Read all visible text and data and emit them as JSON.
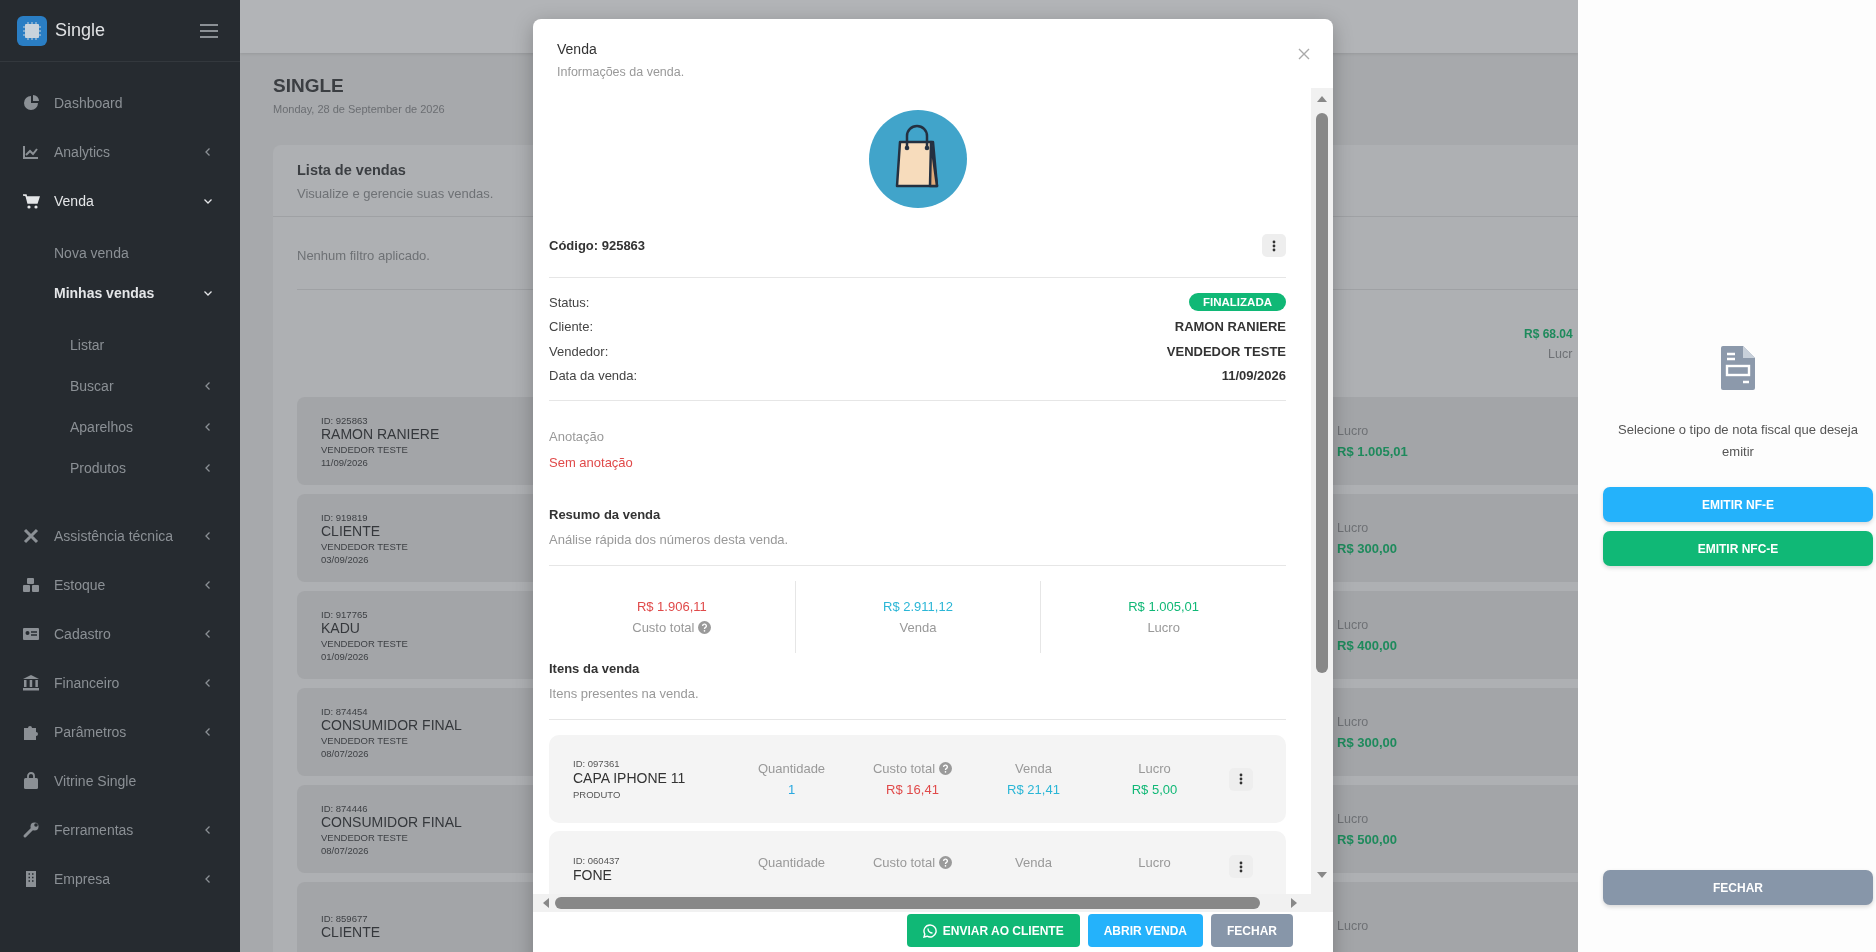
{
  "sidebar": {
    "brand": "Single",
    "items": [
      {
        "label": "Dashboard",
        "selected": false
      },
      {
        "label": "Analytics",
        "selected": false,
        "expanded": false
      },
      {
        "label": "Venda",
        "selected": true,
        "expanded": true,
        "children": [
          {
            "label": "Nova venda",
            "selected": false
          },
          {
            "label": "Minhas vendas",
            "selected": true,
            "expanded": true,
            "children": [
              {
                "label": "Listar",
                "selected": false
              },
              {
                "label": "Buscar",
                "selected": false,
                "expanded": false
              },
              {
                "label": "Aparelhos",
                "selected": false,
                "expanded": false
              },
              {
                "label": "Produtos",
                "selected": false,
                "expanded": false
              }
            ]
          }
        ]
      },
      {
        "label": "Assistência técnica",
        "selected": false,
        "expanded": false
      },
      {
        "label": "Estoque",
        "selected": false,
        "expanded": false
      },
      {
        "label": "Cadastro",
        "selected": false,
        "expanded": false
      },
      {
        "label": "Financeiro",
        "selected": false,
        "expanded": false
      },
      {
        "label": "Parâmetros",
        "selected": false,
        "expanded": false
      },
      {
        "label": "Vitrine Single",
        "selected": false
      },
      {
        "label": "Ferramentas",
        "selected": false,
        "expanded": false
      },
      {
        "label": "Empresa",
        "selected": false,
        "expanded": false
      }
    ]
  },
  "page": {
    "title": "SINGLE",
    "date": "Monday, 28 de September de 2026",
    "card": {
      "title": "Lista de vendas",
      "subtitle": "Visualize e gerencie suas vendas.",
      "filter": "Nenhum filtro aplicado.",
      "summary": {
        "value": "R$ 68.04",
        "label": "Lucr"
      },
      "sales": [
        {
          "id": "ID: 925863",
          "client": "RAMON RANIERE",
          "seller": "VENDEDOR TESTE",
          "date": "11/09/2026",
          "profit_label": "Lucro",
          "profit": "R$ 1.005,01"
        },
        {
          "id": "ID: 919819",
          "client": "CLIENTE",
          "seller": "VENDEDOR TESTE",
          "date": "03/09/2026",
          "profit_label": "Lucro",
          "profit": "R$ 300,00"
        },
        {
          "id": "ID: 917765",
          "client": "KADU",
          "seller": "VENDEDOR TESTE",
          "date": "01/09/2026",
          "profit_label": "Lucro",
          "profit": "R$ 400,00"
        },
        {
          "id": "ID: 874454",
          "client": "CONSUMIDOR FINAL",
          "seller": "VENDEDOR TESTE",
          "date": "08/07/2026",
          "profit_label": "Lucro",
          "profit": "R$ 300,00"
        },
        {
          "id": "ID: 874446",
          "client": "CONSUMIDOR FINAL",
          "seller": "VENDEDOR TESTE",
          "date": "08/07/2026",
          "profit_label": "Lucro",
          "profit": "R$ 500,00"
        },
        {
          "id": "ID: 859677",
          "client": "CLIENTE",
          "profit_label": "Lucro"
        }
      ]
    }
  },
  "modal": {
    "title": "Venda",
    "subtitle": "Informações da venda.",
    "code": "Código: 925863",
    "fields": [
      {
        "label": "Status:",
        "value": "FINALIZADA",
        "kind": "badge"
      },
      {
        "label": "Cliente:",
        "value": "RAMON RANIERE",
        "kind": "text"
      },
      {
        "label": "Vendedor:",
        "value": "VENDEDOR TESTE",
        "kind": "text"
      },
      {
        "label": "Data da venda:",
        "value": "11/09/2026",
        "kind": "text"
      }
    ],
    "note_label": "Anotação",
    "note": "Sem anotação",
    "summary": {
      "title": "Resumo da venda",
      "subtitle": "Análise rápida dos números desta venda.",
      "stats": [
        {
          "value": "R$ 1.906,11",
          "label": "Custo total",
          "color": "#e04a4a",
          "help": true
        },
        {
          "value": "R$ 2.911,12",
          "label": "Venda",
          "color": "#2bb6d6",
          "help": false
        },
        {
          "value": "R$ 1.005,01",
          "label": "Lucro",
          "color": "#10b876",
          "help": false
        }
      ]
    },
    "items": {
      "title": "Itens da venda",
      "subtitle": "Itens presentes na venda.",
      "rows": [
        {
          "id": "ID: 097361",
          "name": "CAPA IPHONE 11",
          "type": "PRODUTO",
          "columns": [
            {
              "label": "Quantidade",
              "value": "1",
              "color": "#29a8e0",
              "help": false
            },
            {
              "label": "Custo total",
              "value": "R$ 16,41",
              "color": "#e04a4a",
              "help": true
            },
            {
              "label": "Venda",
              "value": "R$ 21,41",
              "color": "#2bb6d6",
              "help": false
            },
            {
              "label": "Lucro",
              "value": "R$ 5,00",
              "color": "#10b876",
              "help": false
            }
          ]
        },
        {
          "id": "ID: 060437",
          "name": "FONE",
          "columns": [
            {
              "label": "Quantidade",
              "help": false
            },
            {
              "label": "Custo total",
              "help": true
            },
            {
              "label": "Venda",
              "help": false
            },
            {
              "label": "Lucro",
              "help": false
            }
          ]
        }
      ]
    },
    "buttons": [
      {
        "label": "ENVIAR AO CLIENTE",
        "kind": "whatsapp"
      },
      {
        "label": "ABRIR VENDA",
        "kind": "primary"
      },
      {
        "label": "FECHAR",
        "kind": "secondary"
      }
    ]
  },
  "panel": {
    "message": "Selecione o tipo de nota fiscal que deseja emitir",
    "buttons": [
      {
        "label": "EMITIR NF-E",
        "kind": "primary"
      },
      {
        "label": "EMITIR NFC-E",
        "kind": "success"
      }
    ],
    "close": "FECHAR"
  }
}
